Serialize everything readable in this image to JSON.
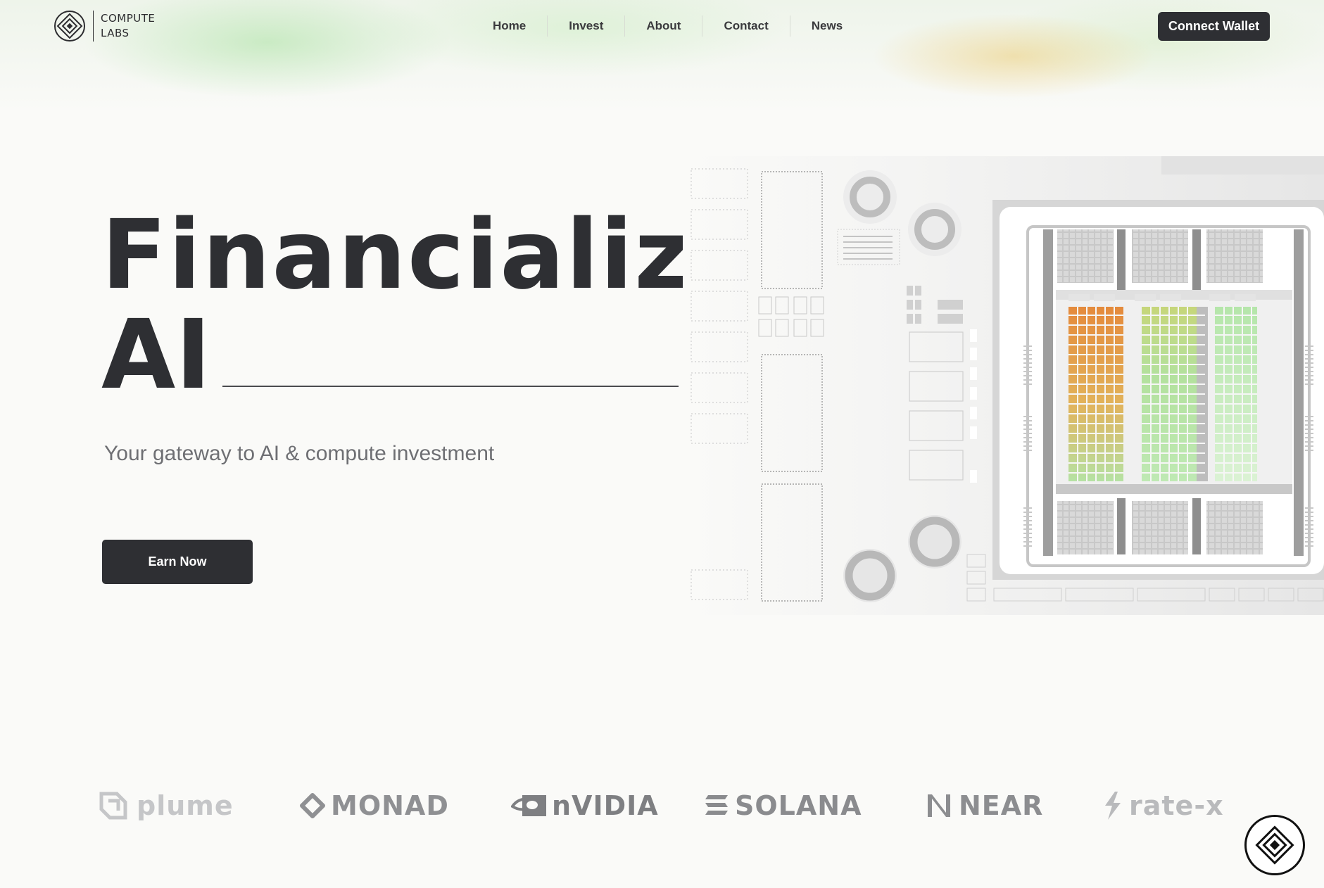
{
  "brand": {
    "line1": "COMPUTE",
    "line2": "LABS",
    "icon": "compute-labs-logo-icon"
  },
  "nav": {
    "items": [
      {
        "label": "Home"
      },
      {
        "label": "Invest"
      },
      {
        "label": "About"
      },
      {
        "label": "Contact"
      },
      {
        "label": "News"
      }
    ]
  },
  "header": {
    "connect_wallet_label": "Connect Wallet"
  },
  "hero": {
    "title_line1": "Financializing",
    "title_line2": "AI",
    "subtitle": "Your gateway to AI & compute investment",
    "cta_label": "Earn Now",
    "illustration": "gpu-chip-illustration"
  },
  "partners": [
    {
      "name": "plume",
      "icon": "plume-logo-icon"
    },
    {
      "name": "MONAD",
      "icon": "monad-logo-icon"
    },
    {
      "name": "nVIDIA",
      "icon": "nvidia-logo-icon"
    },
    {
      "name": "SOLANA",
      "icon": "solana-logo-icon"
    },
    {
      "name": "NEAR",
      "icon": "near-logo-icon"
    },
    {
      "name": "rate-x",
      "icon": "ratex-logo-icon"
    }
  ],
  "colors": {
    "background": "#fafaf8",
    "dark": "#2e2f33",
    "muted_text": "#6e6f73",
    "chip_orange": "#e89a4a",
    "chip_green": "#a8e2a0"
  }
}
